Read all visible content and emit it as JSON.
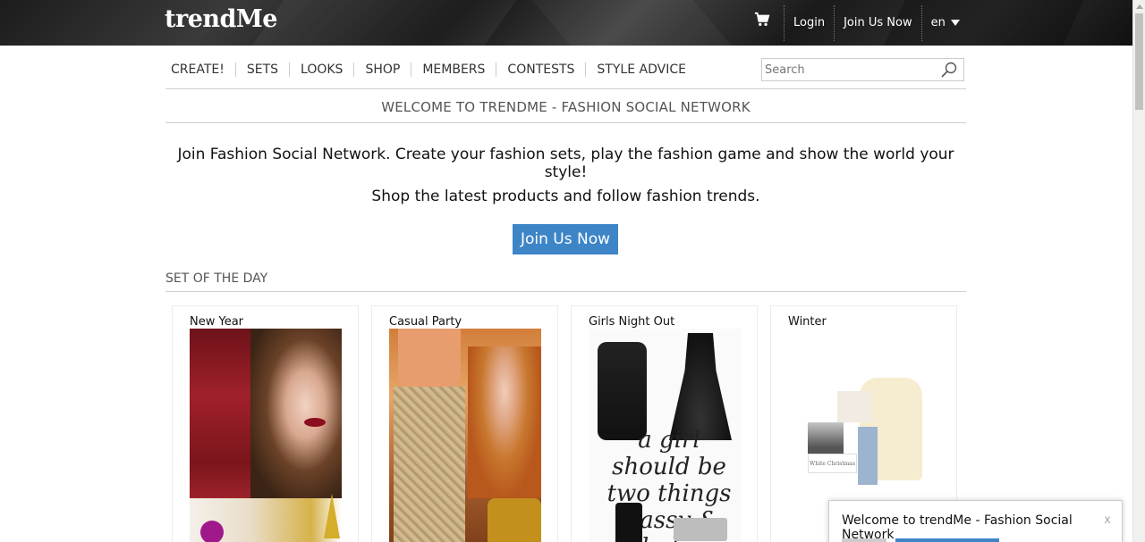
{
  "header": {
    "logo": "trendMe",
    "login": "Login",
    "join": "Join Us Now",
    "language": "en"
  },
  "nav": {
    "items": [
      "CREATE!",
      "SETS",
      "LOOKS",
      "SHOP",
      "MEMBERS",
      "CONTESTS",
      "STYLE ADVICE"
    ]
  },
  "search": {
    "placeholder": "Search"
  },
  "welcome": {
    "title": "WELCOME TO TRENDME - FASHION SOCIAL NETWORK",
    "line1": "Join Fashion Social Network. Create your fashion sets, play the fashion game and show the world your style!",
    "line2": "Shop the latest products and follow fashion trends.",
    "cta": "Join Us Now"
  },
  "set_of_the_day": {
    "title": "SET OF THE DAY",
    "cards": [
      {
        "title": "New Year"
      },
      {
        "title": "Casual Party"
      },
      {
        "title": "Girls Night Out"
      },
      {
        "title": "Winter"
      }
    ]
  },
  "card3_text": "a girl should be two things classy & fabulous",
  "card4_text": "White Christmas",
  "toast": {
    "message": "Welcome to trendMe - Fashion Social Network",
    "close": "x"
  },
  "colors": {
    "accent": "#3d85c6",
    "topbar": "#1c1c1c"
  }
}
